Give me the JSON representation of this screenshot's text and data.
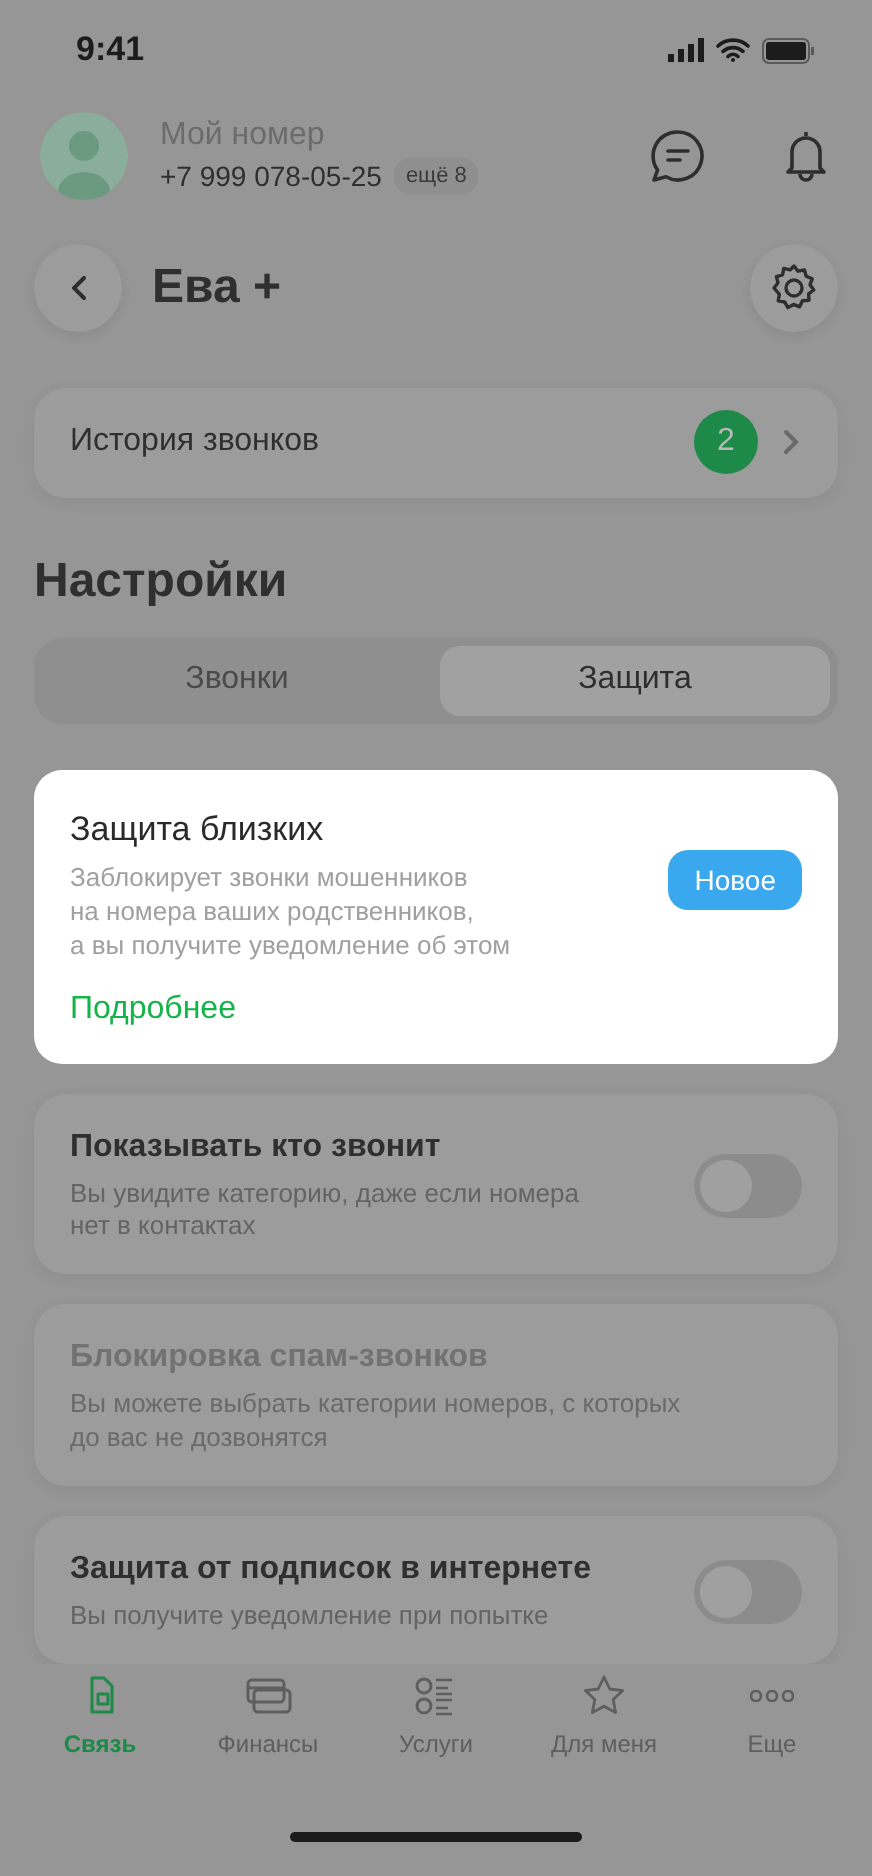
{
  "status_bar": {
    "time": "9:41"
  },
  "account": {
    "label": "Мой номер",
    "phone": "+7 999 078-05-25",
    "more_badge": "ещё 8"
  },
  "service": {
    "title": "Ева +"
  },
  "history": {
    "label": "История звонков",
    "count": "2"
  },
  "section_title": "Настройки",
  "segments": [
    {
      "label": "Звонки",
      "selected": false
    },
    {
      "label": "Защита",
      "selected": true
    }
  ],
  "promo": {
    "title": "Защита близких",
    "description": "Заблокирует звонки мошенников\nна номера ваших родственников,\nа вы получите уведомление об этом",
    "badge": "Новое",
    "link": "Подробнее"
  },
  "settings": [
    {
      "kind": "toggle",
      "title": "Показывать кто звонит",
      "description": "Вы увидите категорию, даже если номера\nнет в контактах",
      "on": false,
      "disabled": false
    },
    {
      "kind": "plain",
      "title": "Блокировка спам-звонков",
      "description": "Вы можете выбрать категории номеров, с которых\nдо вас не дозвонятся",
      "disabled": true
    },
    {
      "kind": "toggle",
      "title": "Защита от подписок в интернете",
      "description": "Вы получите уведомление при попытке",
      "on": false,
      "disabled": false
    }
  ],
  "nav": [
    {
      "label": "Связь",
      "selected": true
    },
    {
      "label": "Финансы",
      "selected": false
    },
    {
      "label": "Услуги",
      "selected": false
    },
    {
      "label": "Для меня",
      "selected": false
    },
    {
      "label": "Еще",
      "selected": false
    }
  ]
}
